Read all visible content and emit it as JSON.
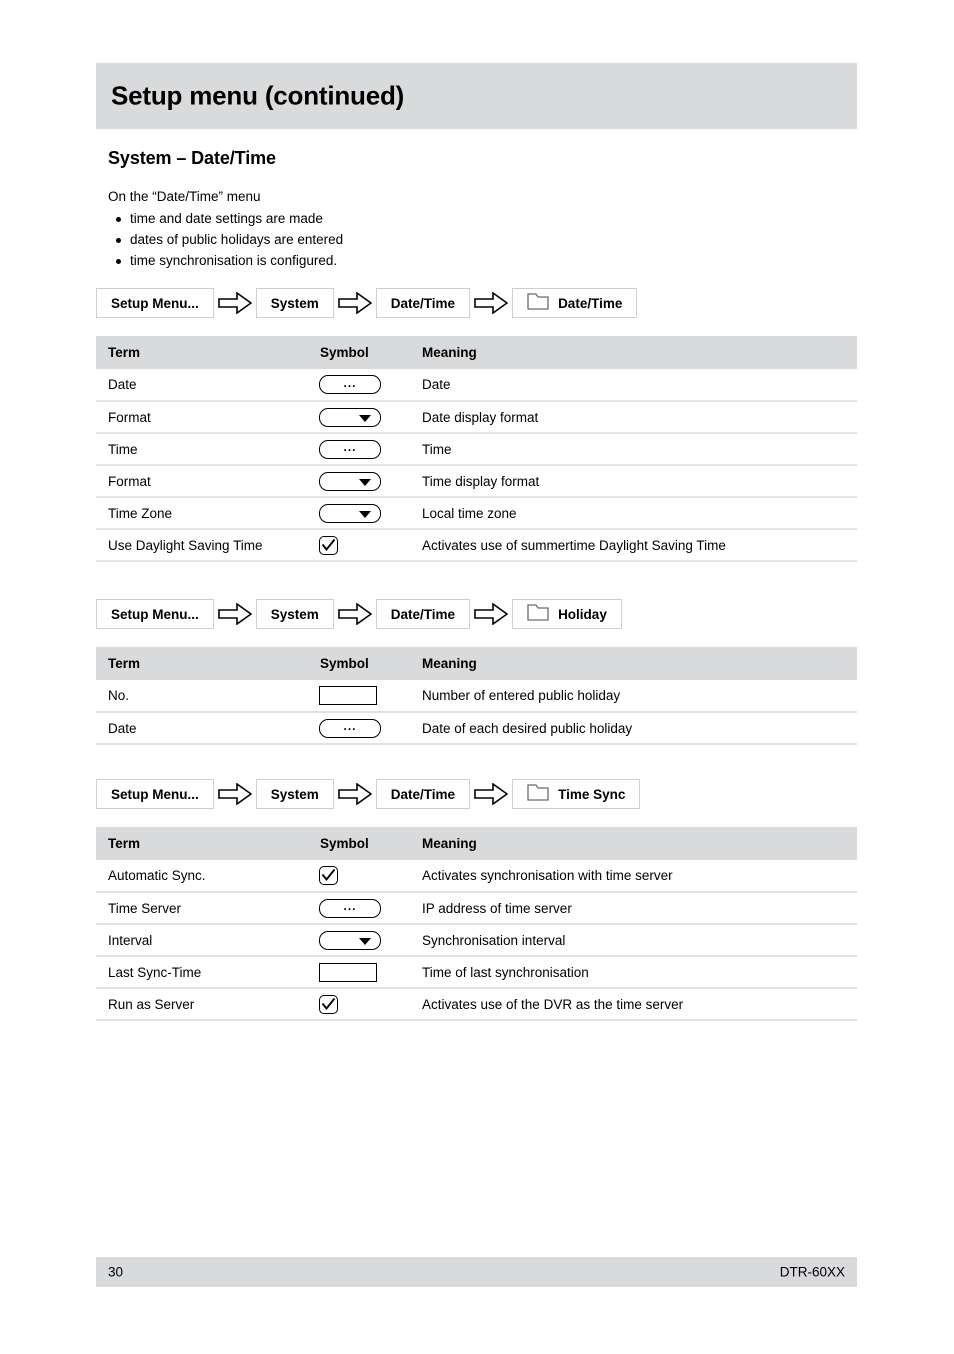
{
  "document": {
    "title": "Setup menu (continued)",
    "section_heading": "System – Date/Time",
    "intro_lead": "On the “Date/Time” menu",
    "intro_bullets": [
      "time and date settings are made",
      "dates of public holidays are entered",
      "time synchronisation is configured."
    ]
  },
  "columns": {
    "term": "Term",
    "symbol": "Symbol",
    "meaning": "Meaning"
  },
  "sections": [
    {
      "breadcrumb": {
        "crumbs": [
          "Setup Menu...",
          "System",
          "Date/Time"
        ],
        "tab": "Date/Time",
        "arrow_icon": "arrow-right-icon",
        "folder_icon": "folder-icon"
      },
      "rows": [
        {
          "term": "Date",
          "symbol": "button-ellipsis",
          "meaning": "Date"
        },
        {
          "term": "Format",
          "symbol": "dropdown",
          "meaning": "Date display format"
        },
        {
          "term": "Time",
          "symbol": "button-ellipsis",
          "meaning": "Time"
        },
        {
          "term": "Format",
          "symbol": "dropdown",
          "meaning": "Time display format"
        },
        {
          "term": "Time Zone",
          "symbol": "dropdown",
          "meaning": "Local time zone"
        },
        {
          "term": "Use Daylight Saving Time",
          "symbol": "checkbox",
          "meaning": "Activates use of summertime Daylight Saving Time"
        }
      ]
    },
    {
      "breadcrumb": {
        "crumbs": [
          "Setup Menu...",
          "System",
          "Date/Time"
        ],
        "tab": "Holiday",
        "arrow_icon": "arrow-right-icon",
        "folder_icon": "folder-icon"
      },
      "rows": [
        {
          "term": "No.",
          "symbol": "text-field",
          "meaning": "Number of entered public holiday"
        },
        {
          "term": "Date",
          "symbol": "button-ellipsis",
          "meaning": "Date of each desired public holiday"
        }
      ]
    },
    {
      "breadcrumb": {
        "crumbs": [
          "Setup Menu...",
          "System",
          "Date/Time"
        ],
        "tab": "Time Sync",
        "arrow_icon": "arrow-right-icon",
        "folder_icon": "folder-icon"
      },
      "rows": [
        {
          "term": "Automatic Sync.",
          "symbol": "checkbox",
          "meaning": "Activates synchronisation with time server"
        },
        {
          "term": "Time Server",
          "symbol": "button-ellipsis",
          "meaning": "IP address of time server"
        },
        {
          "term": "Interval",
          "symbol": "dropdown",
          "meaning": "Synchronisation interval"
        },
        {
          "term": "Last Sync-Time",
          "symbol": "text-field",
          "meaning": "Time of last synchronisation"
        },
        {
          "term": "Run as Server",
          "symbol": "checkbox",
          "meaning": "Activates use of the DVR as the time server"
        }
      ]
    }
  ],
  "footer": {
    "page_number": "30",
    "model": "DTR-60XX"
  },
  "colors": {
    "band_gray": "#d9dadc",
    "row_divider": "#e2e2e3",
    "crumb_border": "#cfcfd1",
    "text": "#000000"
  }
}
